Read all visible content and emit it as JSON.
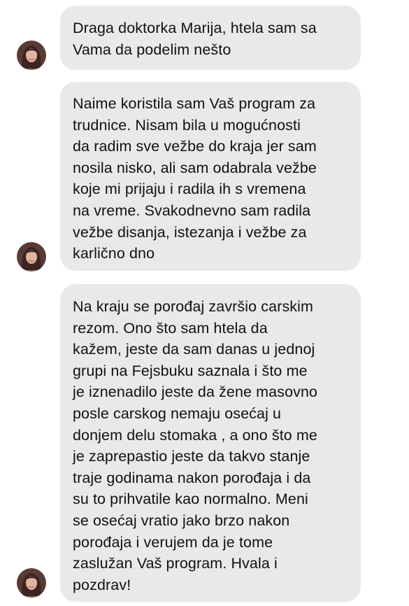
{
  "contact": {
    "avatar_icon": "user-avatar-photo",
    "bubble_color": "#e9e9eb",
    "text_color": "#111111"
  },
  "messages": [
    {
      "text": "Draga doktorka Marija, htela sam sa\nVama da podelim nešto"
    },
    {
      "text": "Naime koristila sam Vaš program za\ntrudnice. Nisam bila u mogućnosti\nda radim sve vežbe do kraja jer sam\nnosila nisko, ali sam odabrala vežbe\nkoje mi prijaju i radila ih s vremena\nna vreme. Svakodnevno sam radila\nvežbe disanja, istezanja i vežbe za\nkarlično dno"
    },
    {
      "text": "Na kraju se porođaj završio carskim\nrezom. Ono što sam htela da\nkažem, jeste da sam danas u jednoj\ngrupi na Fejsbuku saznala i što me\nje iznenadilo jeste da žene masovno\nposle carskog nemaju osećaj u\ndonjem delu stomaka , a ono što me\nje zaprepastio jeste da takvo stanje\ntraje godinama nakon porođaja i da\nsu to prihvatile kao normalno. Meni\nse osećaj vratio jako brzo nakon\nporođaja i verujem da je tome\nzaslužan Vaš program. Hvala i\npozdrav!"
    }
  ]
}
